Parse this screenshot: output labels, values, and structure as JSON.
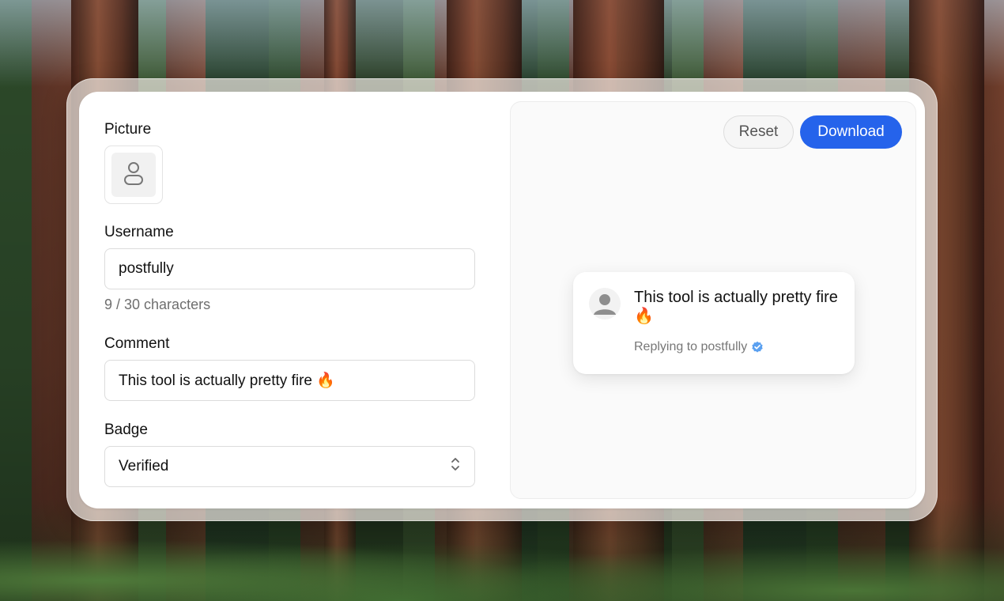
{
  "form": {
    "picture_label": "Picture",
    "username_label": "Username",
    "username_value": "postfully",
    "username_hint": "9 / 30 characters",
    "comment_label": "Comment",
    "comment_value": "This tool is actually pretty fire 🔥",
    "badge_label": "Badge",
    "badge_value": "Verified"
  },
  "preview": {
    "reset_label": "Reset",
    "download_label": "Download",
    "comment_text": "This tool is actually pretty fire 🔥",
    "reply_prefix": "Replying to postfully"
  },
  "colors": {
    "accent": "#2563eb",
    "verified": "#5aa0f0"
  },
  "icons": {
    "picture_placeholder": "user-icon",
    "select_chevron": "chevron-up-down-icon",
    "avatar": "user-silhouette-icon",
    "badge": "verified-badge-icon"
  }
}
